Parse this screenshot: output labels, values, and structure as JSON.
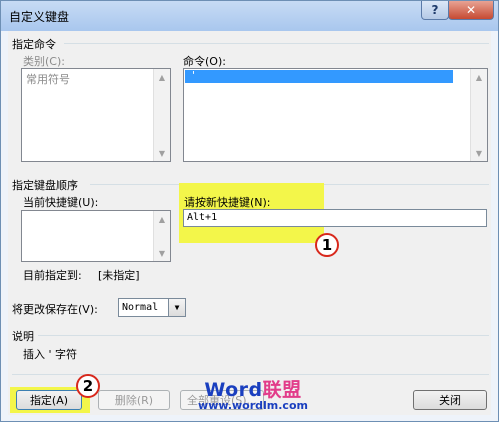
{
  "window": {
    "title": "自定义键盘",
    "help_glyph": "?",
    "close_glyph": "✕"
  },
  "specify_command": {
    "group_label": "指定命令",
    "categories_label": "类别(C):",
    "categories": [
      "常用符号"
    ],
    "commands_label": "命令(O):",
    "commands": [
      "'"
    ]
  },
  "key_sequence": {
    "group_label": "指定键盘顺序",
    "current_keys_label": "当前快捷键(U):",
    "current_keys": [],
    "new_key_label": "请按新快捷键(N):",
    "new_key_value": "Alt+1",
    "currently_assigned_label": "目前指定到:",
    "currently_assigned_value": "[未指定]"
  },
  "save_changes": {
    "label": "将更改保存在(V):",
    "value": "Normal"
  },
  "description": {
    "group_label": "说明",
    "text": "插入 ' 字符"
  },
  "buttons": {
    "assign": "指定(A)",
    "remove": "删除(R)",
    "reset_all": "全部重设(S)...",
    "close": "关闭"
  },
  "annotations": {
    "badge_1": "1",
    "badge_2": "2",
    "highlight_color": "#f3f64a",
    "badge_border_color": "#d8281c"
  },
  "watermark": {
    "top_left": "Word",
    "top_right": "联盟",
    "bottom": "www.wordlm.com"
  }
}
